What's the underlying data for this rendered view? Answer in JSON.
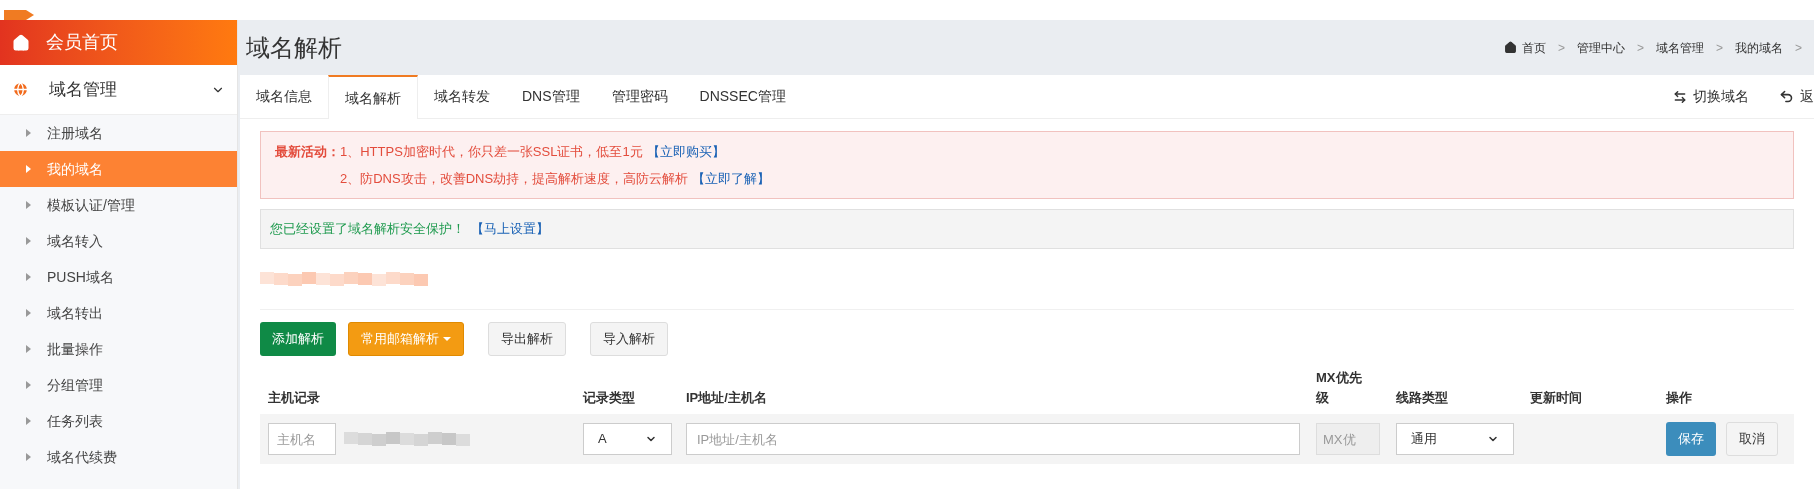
{
  "sidebar": {
    "home": {
      "label": "会员首页"
    },
    "group": {
      "label": "域名管理",
      "expanded": true,
      "items": [
        {
          "label": "注册域名",
          "selected": false
        },
        {
          "label": "我的域名",
          "selected": true
        },
        {
          "label": "模板认证/管理",
          "selected": false
        },
        {
          "label": "域名转入",
          "selected": false
        },
        {
          "label": "PUSH域名",
          "selected": false
        },
        {
          "label": "域名转出",
          "selected": false
        },
        {
          "label": "批量操作",
          "selected": false
        },
        {
          "label": "分组管理",
          "selected": false
        },
        {
          "label": "任务列表",
          "selected": false
        },
        {
          "label": "域名代续费",
          "selected": false
        }
      ]
    }
  },
  "page_title": "域名解析",
  "breadcrumb": [
    {
      "kind": "home",
      "label": "首页"
    },
    {
      "kind": "sep",
      "label": ">"
    },
    {
      "kind": "link",
      "label": "管理中心"
    },
    {
      "kind": "sep",
      "label": ">"
    },
    {
      "kind": "link",
      "label": "域名管理"
    },
    {
      "kind": "sep",
      "label": ">"
    },
    {
      "kind": "link",
      "label": "我的域名"
    },
    {
      "kind": "sep",
      "label": ">"
    }
  ],
  "tabs": [
    {
      "label": "域名信息",
      "selected": false
    },
    {
      "label": "域名解析",
      "selected": true
    },
    {
      "label": "域名转发",
      "selected": false
    },
    {
      "label": "DNS管理",
      "selected": false
    },
    {
      "label": "管理密码",
      "selected": false
    },
    {
      "label": "DNSSEC管理",
      "selected": false
    }
  ],
  "tab_actions": [
    {
      "kind": "switch",
      "label": "切换域名"
    },
    {
      "kind": "back",
      "label": "返"
    }
  ],
  "promo": {
    "label": "最新活动：",
    "items": [
      {
        "text": "1、HTTPS加密时代，你只差一张SSL证书，低至1元",
        "link": "【立即购买】"
      },
      {
        "text": "2、防DNS攻击，改善DNS劫持，提高解析速度，高防云解析",
        "link": "【立即了解】"
      }
    ]
  },
  "notice": {
    "text": "您已经设置了域名解析安全保护！",
    "link": "【马上设置】"
  },
  "toolbar": [
    {
      "kind": "primary",
      "label": "添加解析"
    },
    {
      "kind": "dropdown",
      "label": "常用邮箱解析"
    },
    {
      "kind": "plain",
      "label": "导出解析"
    },
    {
      "kind": "plain",
      "label": "导入解析"
    }
  ],
  "table": {
    "columns": [
      "主机记录",
      "记录类型",
      "IP地址/主机名",
      "MX优先级",
      "线路类型",
      "更新时间",
      "操作"
    ],
    "new_row": {
      "host_placeholder": "主机名",
      "type": "A",
      "ip_placeholder": "IP地址/主机名",
      "mx_placeholder": "MX优",
      "line": "通用",
      "save": "保存",
      "cancel": "取消"
    }
  }
}
